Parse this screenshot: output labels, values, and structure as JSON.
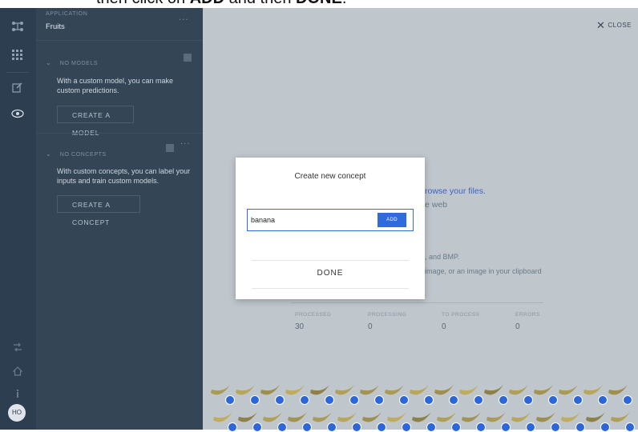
{
  "caption": {
    "pre": "then click on ",
    "add": "ADD",
    "mid": " and then ",
    "done": "DONE",
    "post": "."
  },
  "sidebar_rail": {
    "icons": [
      "logo-icon",
      "grid-icon",
      "edit-icon",
      "eye-icon",
      "share-icon",
      "home-icon",
      "info-icon"
    ],
    "avatar_initials": "HO"
  },
  "panel": {
    "app_caption": "APPLICATION",
    "app_name": "Fruits",
    "models_heading": "NO MODELS",
    "models_text": "With a custom model, you can make custom predictions.",
    "create_model": "CREATE A MODEL",
    "concepts_heading": "NO CONCEPTS",
    "concepts_text": "With custom concepts, you can label your inputs and train custom models.",
    "create_concept": "CREATE A CONCEPT"
  },
  "main": {
    "close_label": "CLOSE",
    "browse_link": "rowse your files.",
    "web_text": "e web",
    "formats_text": ", and BMP.",
    "clipboard_text": "image, or an image in your clipboard",
    "stats": [
      {
        "label": "PROCESSED",
        "value": "30"
      },
      {
        "label": "PROCESSING",
        "value": "0"
      },
      {
        "label": "TO PROCESS",
        "value": "0"
      },
      {
        "label": "ERRORS",
        "value": "0"
      }
    ],
    "accent_color": "#2f6bdf"
  },
  "modal": {
    "title": "Create new concept",
    "input_value": "banana",
    "add_label": "ADD",
    "done_label": "DONE"
  }
}
